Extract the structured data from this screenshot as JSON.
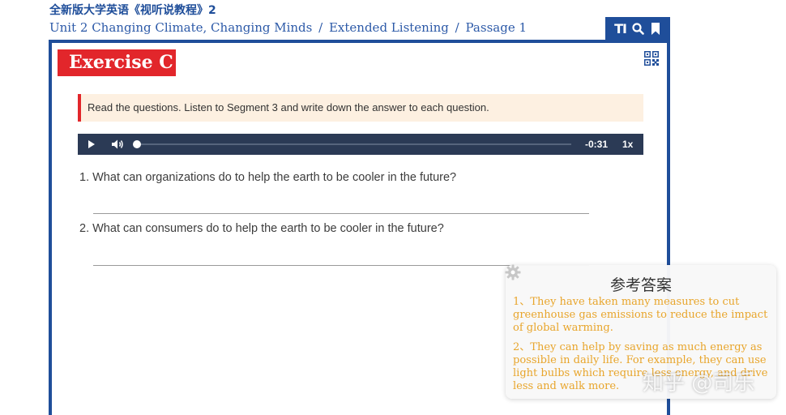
{
  "book_title": "全新版大学英语《视听说教程》2",
  "breadcrumb": {
    "unit": "Unit 2 Changing Climate, Changing Minds",
    "section": "Extended Listening",
    "passage": "Passage 1",
    "separator": "/"
  },
  "toolbar": {
    "text_size_label": "TI",
    "icons": [
      "text-size-icon",
      "search-icon",
      "bookmark-icon"
    ]
  },
  "exercise": {
    "title": "Exercise C",
    "instruction": "Read the questions. Listen to Segment 3 and write down the answer to each question."
  },
  "audio": {
    "time_remaining": "-0:31",
    "speed": "1x",
    "progress": 0.0
  },
  "questions": [
    {
      "number": "1.",
      "text": "What can organizations do to help the earth to be cooler in the future?",
      "answer": ""
    },
    {
      "number": "2.",
      "text": "What can consumers do to help the earth to be cooler in the future?",
      "answer": ""
    }
  ],
  "reference": {
    "title": "参考答案",
    "answers": [
      "1、They have taken many measures to cut greenhouse gas emissions to reduce the impact of global warming.",
      "2、They can help by saving as much energy as possible in daily life. For example, they can use light bulbs which require less energy, and drive less and walk more."
    ]
  },
  "watermark": "知乎 @司乐",
  "colors": {
    "primary_blue": "#1f4e9a",
    "accent_red": "#e2262b",
    "instruction_bg": "#fdf0e1",
    "player_bg": "#2b3a55",
    "answer_text": "#e8a52b"
  }
}
